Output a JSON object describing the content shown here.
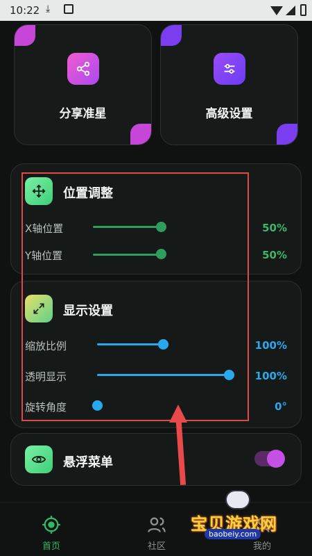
{
  "status_bar": {
    "time": "10:22",
    "download_glyph": "⤓"
  },
  "cards": [
    {
      "label": "分享准星",
      "icon": "share-icon",
      "accent": "#c646d8"
    },
    {
      "label": "高级设置",
      "icon": "sliders-icon",
      "accent": "#7a3ef0"
    }
  ],
  "position": {
    "title": "位置调整",
    "icon": "move-icon",
    "accent": "#3fb56b",
    "rows": [
      {
        "label": "X轴位置",
        "value": "50%",
        "level": 0.5
      },
      {
        "label": "Y轴位置",
        "value": "50%",
        "level": 0.5
      }
    ]
  },
  "display": {
    "title": "显示设置",
    "icon": "expand-icon",
    "accent": "#29a8ee",
    "rows": [
      {
        "label": "缩放比例",
        "value": "100%"
      },
      {
        "label": "透明显示",
        "value": "100%"
      },
      {
        "label": "旋转角度",
        "value": "0°"
      }
    ]
  },
  "floating_menu": {
    "label": "悬浮菜单",
    "icon": "eye-icon",
    "enabled": true
  },
  "bottom_nav": [
    {
      "label": "首页",
      "icon": "crosshair-icon",
      "active": true
    },
    {
      "label": "社区",
      "icon": "users-icon",
      "active": false
    },
    {
      "label": "我的",
      "icon": "user-icon",
      "active": false
    }
  ],
  "watermark": {
    "title": "宝贝游戏网",
    "sub": "baobeiy.com"
  }
}
